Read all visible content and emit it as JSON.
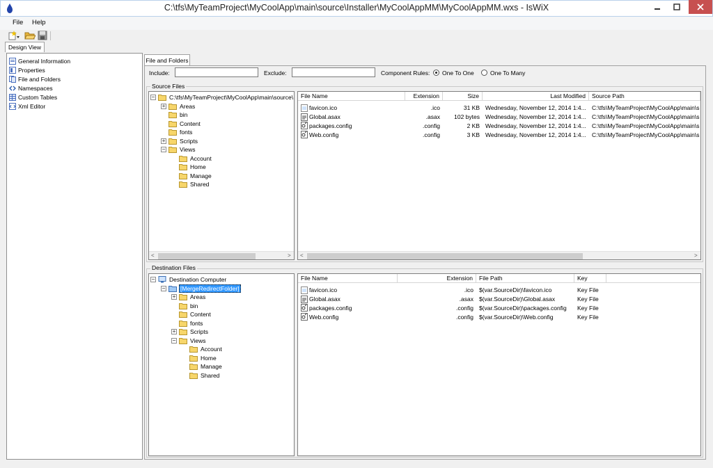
{
  "window": {
    "title": "C:\\tfs\\MyTeamProject\\MyCoolApp\\main\\source\\Installer\\MyCoolAppMM\\MyCoolAppMM.wxs - IsWiX"
  },
  "menu": {
    "file": "File",
    "help": "Help"
  },
  "toolbar": {
    "icons": [
      "new-dropdown-icon",
      "open-folder-icon",
      "save-icon"
    ]
  },
  "left": {
    "tab_label": "Design View",
    "items": [
      {
        "label": "General Information",
        "icon": "general-info-icon"
      },
      {
        "label": "Properties",
        "icon": "properties-icon"
      },
      {
        "label": "File and Folders",
        "icon": "files-icon"
      },
      {
        "label": "Namespaces",
        "icon": "namespaces-icon"
      },
      {
        "label": "Custom Tables",
        "icon": "custom-tables-icon"
      },
      {
        "label": "Xml Editor",
        "icon": "xml-editor-icon"
      }
    ]
  },
  "main": {
    "tab_label": "File and Folders",
    "include_label": "Include:",
    "include_value": "",
    "exclude_label": "Exclude:",
    "exclude_value": "",
    "component_rules_label": "Component Rules:",
    "rule_one_to_one": "One To One",
    "rule_one_to_many": "One To Many",
    "selected_rule": "One To One"
  },
  "source": {
    "group_label": "Source Files",
    "root": "C:\\tfs\\MyTeamProject\\MyCoolApp\\main\\source\\",
    "tree": [
      {
        "label": "Areas",
        "level": 1,
        "exp": "+"
      },
      {
        "label": "bin",
        "level": 1,
        "exp": ""
      },
      {
        "label": "Content",
        "level": 1,
        "exp": ""
      },
      {
        "label": "fonts",
        "level": 1,
        "exp": ""
      },
      {
        "label": "Scripts",
        "level": 1,
        "exp": "+"
      },
      {
        "label": "Views",
        "level": 1,
        "exp": "−"
      },
      {
        "label": "Account",
        "level": 2,
        "exp": ""
      },
      {
        "label": "Home",
        "level": 2,
        "exp": ""
      },
      {
        "label": "Manage",
        "level": 2,
        "exp": ""
      },
      {
        "label": "Shared",
        "level": 2,
        "exp": ""
      }
    ],
    "columns": [
      "File Name",
      "Extension",
      "Size",
      "Last Modified",
      "Source Path"
    ],
    "files": [
      {
        "name": "favicon.ico",
        "ext": ".ico",
        "size": "31 KB",
        "modified": "Wednesday, November 12, 2014 1:4...",
        "path": "C:\\tfs\\MyTeamProject\\MyCoolApp\\main\\s"
      },
      {
        "name": "Global.asax",
        "ext": ".asax",
        "size": "102 bytes",
        "modified": "Wednesday, November 12, 2014 1:4...",
        "path": "C:\\tfs\\MyTeamProject\\MyCoolApp\\main\\s"
      },
      {
        "name": "packages.config",
        "ext": ".config",
        "size": "2 KB",
        "modified": "Wednesday, November 12, 2014 1:4...",
        "path": "C:\\tfs\\MyTeamProject\\MyCoolApp\\main\\s"
      },
      {
        "name": "Web.config",
        "ext": ".config",
        "size": "3 KB",
        "modified": "Wednesday, November 12, 2014 1:4...",
        "path": "C:\\tfs\\MyTeamProject\\MyCoolApp\\main\\s"
      }
    ]
  },
  "destination": {
    "group_label": "Destination Files",
    "root": "Destination Computer",
    "merge_folder": "[MergeRedirectFolder]",
    "tree": [
      {
        "label": "Areas",
        "level": 2,
        "exp": "+"
      },
      {
        "label": "bin",
        "level": 2,
        "exp": ""
      },
      {
        "label": "Content",
        "level": 2,
        "exp": ""
      },
      {
        "label": "fonts",
        "level": 2,
        "exp": ""
      },
      {
        "label": "Scripts",
        "level": 2,
        "exp": "+"
      },
      {
        "label": "Views",
        "level": 2,
        "exp": "−"
      },
      {
        "label": "Account",
        "level": 3,
        "exp": ""
      },
      {
        "label": "Home",
        "level": 3,
        "exp": ""
      },
      {
        "label": "Manage",
        "level": 3,
        "exp": ""
      },
      {
        "label": "Shared",
        "level": 3,
        "exp": ""
      }
    ],
    "columns": [
      "File Name",
      "Extension",
      "File Path",
      "Key"
    ],
    "files": [
      {
        "name": "favicon.ico",
        "ext": ".ico",
        "path": "$(var.SourceDir)\\favicon.ico",
        "key": "Key File"
      },
      {
        "name": "Global.asax",
        "ext": ".asax",
        "path": "$(var.SourceDir)\\Global.asax",
        "key": "Key File"
      },
      {
        "name": "packages.config",
        "ext": ".config",
        "path": "$(var.SourceDir)\\packages.config",
        "key": "Key File"
      },
      {
        "name": "Web.config",
        "ext": ".config",
        "path": "$(var.SourceDir)\\Web.config",
        "key": "Key File"
      }
    ]
  },
  "colors": {
    "folder": "#f7d66b",
    "selection": "#3399ff",
    "close": "#c75050"
  }
}
